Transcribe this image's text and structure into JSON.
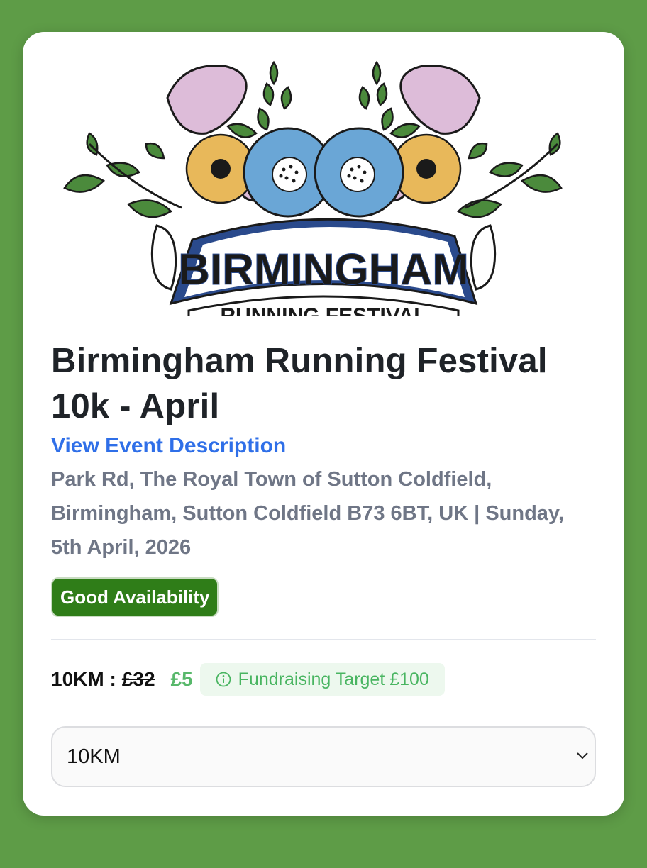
{
  "event": {
    "title": "Birmingham Running Festival 10k - April",
    "description_link": "View Event Description",
    "address": "Park Rd, The Royal Town of Sutton Coldfield, Birmingham, Sutton Coldfield B73 6BT, UK | Sunday, 5th April, 2026",
    "availability": "Good Availability"
  },
  "logo": {
    "banner_text": "BIRMINGHAM",
    "sub_text": "RUNNING FESTIVAL"
  },
  "pricing": {
    "distance_label": "10KM :",
    "old_price": "£32",
    "new_price": "£5",
    "fundraising": "Fundraising Target £100"
  },
  "select": {
    "value": "10KM"
  },
  "colors": {
    "page_background": "#5e9c47",
    "link": "#2f6fe8",
    "availability_badge": "#2f7d18",
    "price_green": "#58b86b",
    "banner_blue": "#2a4a8c"
  }
}
